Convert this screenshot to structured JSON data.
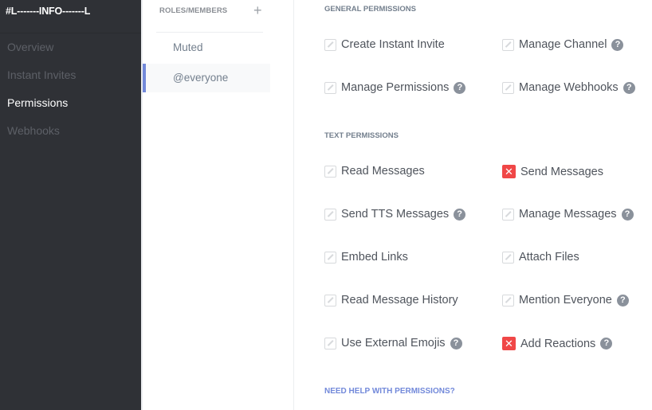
{
  "sidebar": {
    "channel_name": "#L-------INFO-------L",
    "items": [
      {
        "label": "Overview",
        "active": false
      },
      {
        "label": "Instant Invites",
        "active": false
      },
      {
        "label": "Permissions",
        "active": true
      },
      {
        "label": "Webhooks",
        "active": false
      }
    ]
  },
  "roles": {
    "header": "ROLES/MEMBERS",
    "add_icon": "+",
    "items": [
      {
        "label": "Muted",
        "selected": false
      },
      {
        "label": "@everyone",
        "selected": true
      }
    ]
  },
  "permissions": {
    "general_title": "GENERAL PERMISSIONS",
    "general": [
      {
        "label": "Create Instant Invite",
        "state": "neutral",
        "help": false
      },
      {
        "label": "Manage Channel",
        "state": "neutral",
        "help": true
      },
      {
        "label": "Manage Permissions",
        "state": "neutral",
        "help": true
      },
      {
        "label": "Manage Webhooks",
        "state": "neutral",
        "help": true
      }
    ],
    "text_title": "TEXT PERMISSIONS",
    "text": [
      {
        "label": "Read Messages",
        "state": "neutral",
        "help": false
      },
      {
        "label": "Send Messages",
        "state": "deny",
        "help": false
      },
      {
        "label": "Send TTS Messages",
        "state": "neutral",
        "help": true
      },
      {
        "label": "Manage Messages",
        "state": "neutral",
        "help": true
      },
      {
        "label": "Embed Links",
        "state": "neutral",
        "help": false
      },
      {
        "label": "Attach Files",
        "state": "neutral",
        "help": false
      },
      {
        "label": "Read Message History",
        "state": "neutral",
        "help": false
      },
      {
        "label": "Mention Everyone",
        "state": "neutral",
        "help": true
      },
      {
        "label": "Use External Emojis",
        "state": "neutral",
        "help": true
      },
      {
        "label": "Add Reactions",
        "state": "deny",
        "help": true
      }
    ],
    "help_link": "NEED HELP WITH PERMISSIONS?",
    "deny_glyph": "✕",
    "help_glyph": "?"
  },
  "colors": {
    "accent": "#7289da",
    "deny": "#f04747",
    "sidebar_bg": "#2f3136"
  }
}
